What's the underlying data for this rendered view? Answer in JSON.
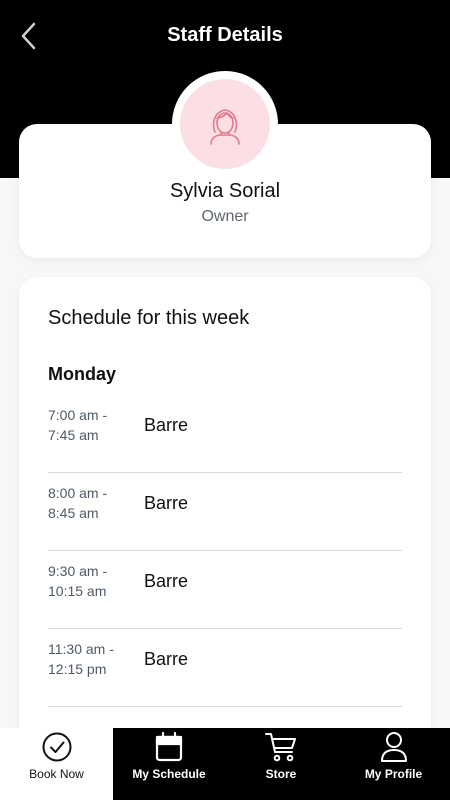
{
  "header": {
    "title": "Staff Details",
    "back_icon": "chevron-left-icon"
  },
  "staff": {
    "name": "Sylvia Sorial",
    "role": "Owner",
    "avatar_icon": "woman-avatar-icon",
    "avatar_bg": "#fbdfe4",
    "avatar_stroke": "#e07a8d"
  },
  "schedule": {
    "title": "Schedule for this week",
    "days": [
      {
        "day": "Monday",
        "sessions": [
          {
            "start": "7:00 am -",
            "end": "7:45 am",
            "class": "Barre"
          },
          {
            "start": "8:00 am -",
            "end": "8:45 am",
            "class": "Barre"
          },
          {
            "start": "9:30 am -",
            "end": "10:15 am",
            "class": "Barre"
          },
          {
            "start": "11:30 am -",
            "end": "12:15 pm",
            "class": "Barre"
          }
        ]
      }
    ]
  },
  "tabs": [
    {
      "label": "Book Now",
      "icon": "check-circle-icon",
      "active": true
    },
    {
      "label": "My Schedule",
      "icon": "calendar-icon",
      "active": false
    },
    {
      "label": "Store",
      "icon": "cart-icon",
      "active": false
    },
    {
      "label": "My Profile",
      "icon": "user-icon",
      "active": false
    }
  ],
  "colors": {
    "header_bg": "#000000",
    "page_bg": "#f7f7f8",
    "card_bg": "#ffffff",
    "muted_text": "#4f5a66"
  }
}
